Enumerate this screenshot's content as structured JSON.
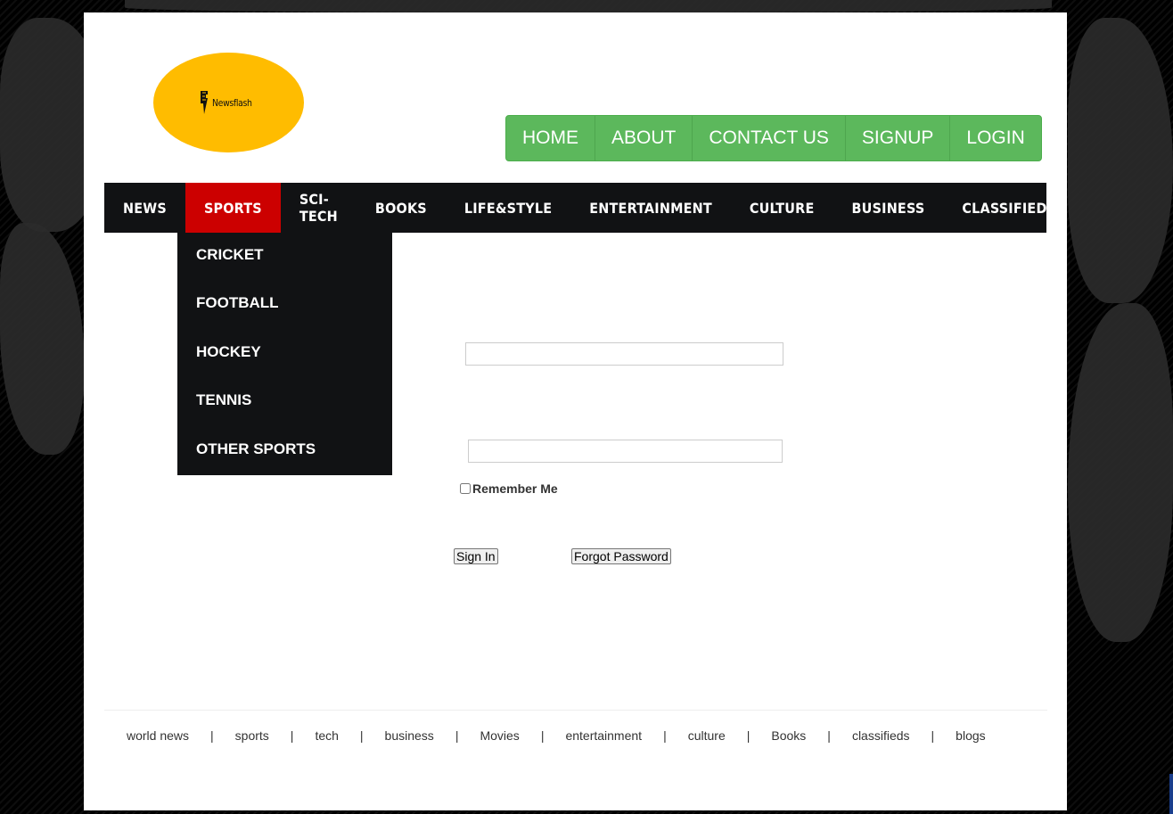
{
  "logo": {
    "text": "Newsflash"
  },
  "top_nav": [
    "HOME",
    "ABOUT",
    "CONTACT US",
    "SIGNUP",
    "LOGIN"
  ],
  "main_nav": [
    {
      "label": "NEWS",
      "active": false
    },
    {
      "label": "SPORTS",
      "active": true
    },
    {
      "label": "SCI-TECH",
      "active": false
    },
    {
      "label": "BOOKS",
      "active": false
    },
    {
      "label": "LIFE&STYLE",
      "active": false
    },
    {
      "label": "ENTERTAINMENT",
      "active": false
    },
    {
      "label": "CULTURE",
      "active": false
    },
    {
      "label": "BUSINESS",
      "active": false
    },
    {
      "label": "CLASSIFIEDS",
      "active": false
    }
  ],
  "dropdown": [
    "CRICKET",
    "FOOTBALL",
    "HOCKEY",
    "TENNIS",
    "OTHER SPORTS"
  ],
  "form": {
    "username_value": "",
    "password_value": "",
    "remember_label": "Remember Me",
    "sign_in_label": "Sign In",
    "forgot_label": "Forgot Password"
  },
  "footer": [
    "world news",
    "sports",
    "tech",
    "business",
    "Movies",
    "entertainment",
    "culture",
    "Books",
    "classifieds",
    "blogs"
  ],
  "colors": {
    "logo_bg": "#ffbc00",
    "top_nav_bg": "#5cb85c",
    "main_nav_bg": "#111214",
    "active_bg": "#cc0000"
  }
}
